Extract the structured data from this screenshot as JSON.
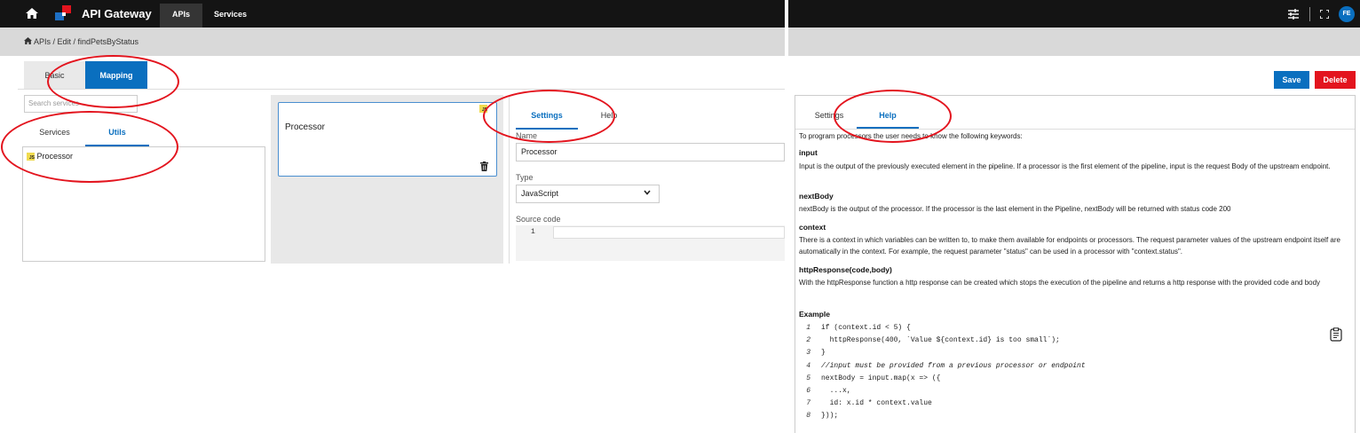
{
  "header": {
    "app_title": "API Gateway",
    "nav": [
      "APIs",
      "Services"
    ],
    "user_initials": "FE"
  },
  "breadcrumb": "APIs / Edit / findPetsByStatus",
  "main_tabs": [
    "Basic",
    "Mapping"
  ],
  "search": {
    "placeholder": "Search services"
  },
  "sub_tabs": [
    "Services",
    "Utils"
  ],
  "utils_list": [
    {
      "badge": "JS",
      "label": "Processor"
    }
  ],
  "card": {
    "title": "Processor",
    "badge": "JS"
  },
  "settings": {
    "tabs": [
      "Settings",
      "Help"
    ],
    "name_label": "Name",
    "name_value": "Processor",
    "type_label": "Type",
    "type_value": "JavaScript",
    "source_label": "Source code",
    "line_no": "1"
  },
  "actions": {
    "save": "Save",
    "delete": "Delete"
  },
  "help": {
    "tabs": [
      "Settings",
      "Help"
    ],
    "intro": "To program processors the user needs to know the following keywords:",
    "keywords": [
      {
        "name": "input",
        "desc": "Input is the output of the previously executed element in the pipeline. If a processor is the first element of the pipeline, input is the request Body of the upstream endpoint."
      },
      {
        "name": "nextBody",
        "desc": "nextBody is the output of the processor. If the processor is the last element in the Pipeline, nextBody will be returned with status code 200"
      },
      {
        "name": "context",
        "desc": "There is a context in which variables can be written to, to make them available for endpoints or processors. The request parameter values of the upstream endpoint itself are automatically in the context. For example, the request parameter \"status\" can be used in a processor with \"context.status\"."
      },
      {
        "name": "httpResponse(code,body)",
        "desc": "With the httpResponse function a http response can be created which stops the execution of the pipeline and returns a http response with the provided code and body"
      }
    ],
    "example_label": "Example",
    "example_code": [
      {
        "n": "1",
        "t": "if (context.id < 5) {"
      },
      {
        "n": "2",
        "t": "  httpResponse(400, `Value ${context.id} is too small`);"
      },
      {
        "n": "3",
        "t": "}"
      },
      {
        "n": "4",
        "t": "//input must be provided from a previous processor or endpoint"
      },
      {
        "n": "5",
        "t": "nextBody = input.map(x => ({"
      },
      {
        "n": "6",
        "t": "  ...x,"
      },
      {
        "n": "7",
        "t": "  id: x.id * context.value"
      },
      {
        "n": "8",
        "t": "}));"
      }
    ]
  },
  "colors": {
    "accent": "#0a6fbf",
    "danger": "#e3141e",
    "topbar": "#141414",
    "annotation": "#e3141e"
  }
}
